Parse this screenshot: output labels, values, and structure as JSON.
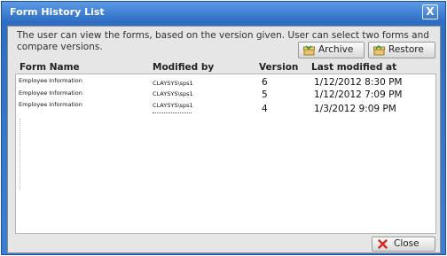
{
  "window": {
    "title": "Form History List",
    "close_glyph": "X"
  },
  "description": "The user can view the forms, based on the version given. User can select two forms and compare versions.",
  "toolbar": {
    "archive_label": "Archive",
    "archive_icon": "archive-icon",
    "restore_label": "Restore",
    "restore_icon": "restore-icon"
  },
  "table": {
    "headers": {
      "form_name": "Form Name",
      "modified_by": "Modified by",
      "version": "Version",
      "last_modified": "Last modified at"
    },
    "rows": [
      {
        "form_name": "Employee Information",
        "modified_by": "CLAYSYS\\sps1",
        "version": "6",
        "last_modified": "1/12/2012 8:30 PM"
      },
      {
        "form_name": "Employee Information",
        "modified_by": "CLAYSYS\\sps1",
        "version": "5",
        "last_modified": "1/12/2012 7:09 PM"
      },
      {
        "form_name": "Employee Information",
        "modified_by": "CLAYSYS\\sps1",
        "version": "4",
        "last_modified": "1/3/2012 9:09 PM"
      }
    ]
  },
  "footer": {
    "close_label": "Close",
    "close_icon": "close-icon"
  },
  "colors": {
    "title_bar": "#2e6fc6",
    "panel": "#e6e6e6",
    "close_icon_red": "#d42a1e"
  }
}
